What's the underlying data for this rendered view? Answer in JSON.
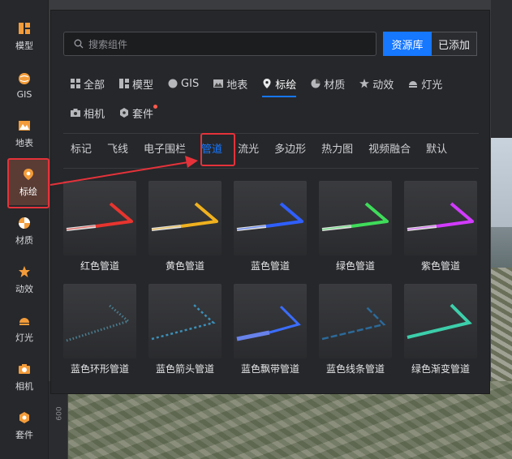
{
  "sidebar": {
    "items": [
      {
        "label": "模型",
        "icon": "model-icon"
      },
      {
        "label": "GIS",
        "icon": "gis-icon"
      },
      {
        "label": "地表",
        "icon": "terrain-icon"
      },
      {
        "label": "标绘",
        "icon": "plot-marker-icon"
      },
      {
        "label": "材质",
        "icon": "material-icon"
      },
      {
        "label": "动效",
        "icon": "effect-icon"
      },
      {
        "label": "灯光",
        "icon": "light-icon"
      },
      {
        "label": "相机",
        "icon": "camera-icon"
      },
      {
        "label": "套件",
        "icon": "kit-icon"
      }
    ],
    "active_index": 3
  },
  "search": {
    "placeholder": "搜索组件"
  },
  "library_buttons": {
    "primary": "资源库",
    "secondary": "已添加"
  },
  "categories": [
    {
      "label": "全部",
      "icon": "grid-icon"
    },
    {
      "label": "模型",
      "icon": "model-icon"
    },
    {
      "label": "GIS",
      "icon": "gis-icon"
    },
    {
      "label": "地表",
      "icon": "terrain-icon"
    },
    {
      "label": "标绘",
      "icon": "plot-marker-icon"
    },
    {
      "label": "材质",
      "icon": "material-icon"
    },
    {
      "label": "动效",
      "icon": "effect-icon"
    },
    {
      "label": "灯光",
      "icon": "light-icon"
    },
    {
      "label": "相机",
      "icon": "camera-icon"
    },
    {
      "label": "套件",
      "icon": "kit-icon"
    }
  ],
  "active_category": "标绘",
  "subcategories": [
    "标记",
    "飞线",
    "电子围栏",
    "管道",
    "流光",
    "多边形",
    "热力图",
    "视频融合",
    "默认"
  ],
  "active_subcategory": "管道",
  "items": [
    {
      "name": "红色管道",
      "color": "#e8342e",
      "style": "solid"
    },
    {
      "name": "黄色管道",
      "color": "#f0b11e",
      "style": "solid"
    },
    {
      "name": "蓝色管道",
      "color": "#2f5fff",
      "style": "solid"
    },
    {
      "name": "绿色管道",
      "color": "#3fdc5a",
      "style": "solid"
    },
    {
      "name": "紫色管道",
      "color": "#d23bff",
      "style": "solid"
    },
    {
      "name": "蓝色环形管道",
      "color": "#4a7d90",
      "style": "rings"
    },
    {
      "name": "蓝色箭头管道",
      "color": "#3c8fb8",
      "style": "arrows"
    },
    {
      "name": "蓝色飘带管道",
      "color": "#3b6dff",
      "style": "ribbon"
    },
    {
      "name": "蓝色线条管道",
      "color": "#2c6a9a",
      "style": "lines"
    },
    {
      "name": "绿色渐变管道",
      "color": "#3ee0b8",
      "style": "gradient"
    }
  ],
  "colors": {
    "accent": "#1677ff",
    "highlight_box": "#e5323a",
    "badge": "#ff5a4d"
  },
  "ruler_label": "600"
}
